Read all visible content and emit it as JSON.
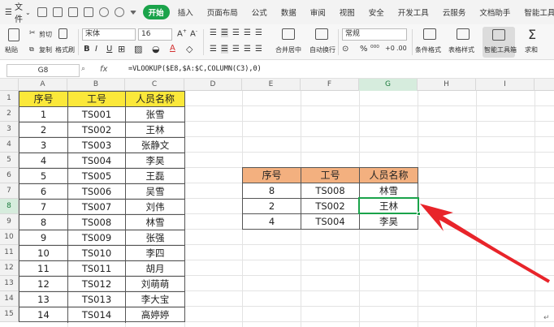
{
  "menubar": {
    "file_label": "文件",
    "tabs": [
      "开始",
      "插入",
      "页面布局",
      "公式",
      "数据",
      "审阅",
      "视图",
      "安全",
      "开发工具",
      "云服务",
      "文档助手",
      "智能工具箱"
    ],
    "active_tab": "开始"
  },
  "ribbon": {
    "paste": "粘贴",
    "cut": "剪切",
    "copy": "复制",
    "format_painter": "格式刷",
    "font_name": "宋体",
    "font_size": "16",
    "merge_center": "合并居中",
    "wrap_text": "自动换行",
    "number_format": "常规",
    "conditional_format": "条件格式",
    "table_style": "表格样式",
    "smart_toolbox": "智能工具箱",
    "sum": "求和"
  },
  "formula_bar": {
    "name_box": "G8",
    "fx": "fx",
    "formula": "=VLOOKUP($E8,$A:$C,COLUMN(C3),0)"
  },
  "columns": [
    "A",
    "B",
    "C",
    "D",
    "E",
    "F",
    "G",
    "H",
    "I"
  ],
  "rows": [
    "1",
    "2",
    "3",
    "4",
    "5",
    "6",
    "7",
    "8",
    "9",
    "10",
    "11",
    "12",
    "13",
    "14",
    "15"
  ],
  "table1": {
    "headers": [
      "序号",
      "工号",
      "人员名称"
    ],
    "rows": [
      [
        "1",
        "TS001",
        "张雪"
      ],
      [
        "2",
        "TS002",
        "王林"
      ],
      [
        "3",
        "TS003",
        "张静文"
      ],
      [
        "4",
        "TS004",
        "李昊"
      ],
      [
        "5",
        "TS005",
        "王磊"
      ],
      [
        "6",
        "TS006",
        "吴雪"
      ],
      [
        "7",
        "TS007",
        "刘伟"
      ],
      [
        "8",
        "TS008",
        "林雪"
      ],
      [
        "9",
        "TS009",
        "张强"
      ],
      [
        "10",
        "TS010",
        "李四"
      ],
      [
        "11",
        "TS011",
        "胡月"
      ],
      [
        "12",
        "TS012",
        "刘萌萌"
      ],
      [
        "13",
        "TS013",
        "李大宝"
      ],
      [
        "14",
        "TS014",
        "高婷婷"
      ]
    ]
  },
  "table2": {
    "headers": [
      "序号",
      "工号",
      "人员名称"
    ],
    "rows": [
      [
        "8",
        "TS008",
        "林雪"
      ],
      [
        "2",
        "TS002",
        "王林"
      ],
      [
        "4",
        "TS004",
        "李昊"
      ]
    ]
  },
  "colors": {
    "accent": "#1aa34a",
    "header_yellow": "#fbe83a",
    "header_orange": "#f3b07f",
    "arrow_red": "#e8242a"
  }
}
